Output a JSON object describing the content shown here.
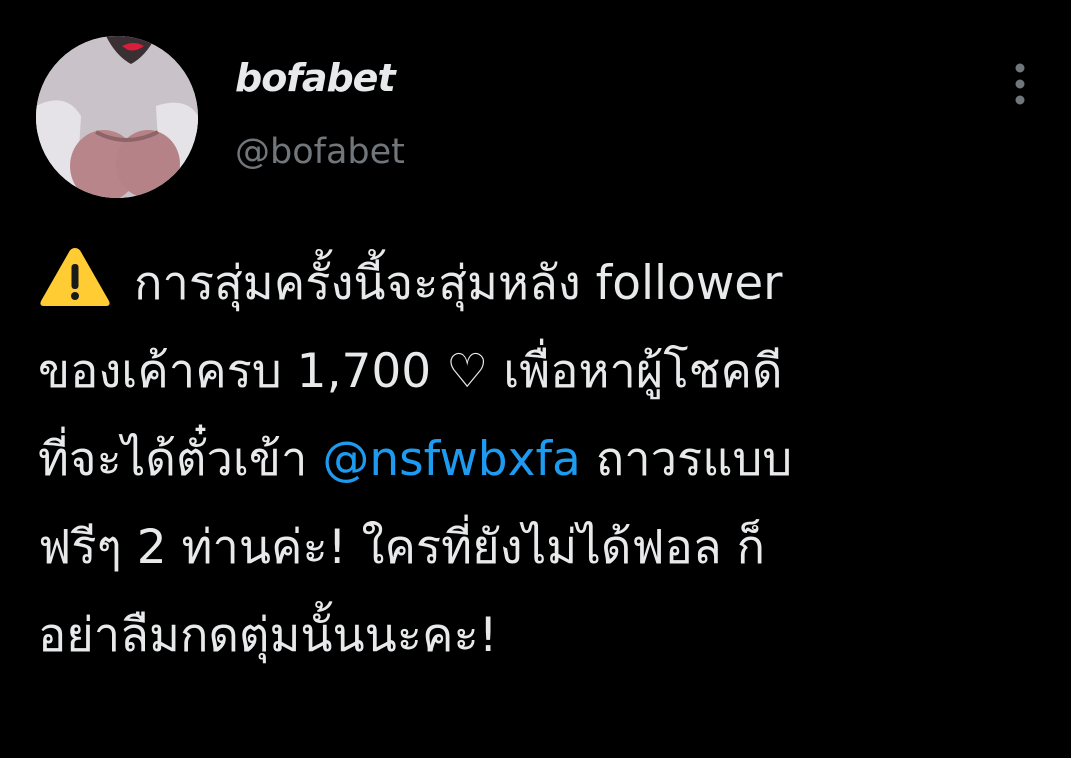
{
  "author": {
    "display_name": "bofabet",
    "handle": "@bofabet",
    "avatar_icon": "profile-photo"
  },
  "tweet": {
    "warning_icon": "warning-icon",
    "line1_text": "การสุ่มครั้งนี้จะสุ่มหลัง follower",
    "line2_text": "ของเค้าครบ 1,700 ♡ เพื่อหาผู้โชคดี",
    "line3_before": "ที่จะได้ตั๋วเข้า ",
    "line3_mention": "@nsfwbxfa",
    "line3_after": " ถาวรแบบ",
    "line4_text": "ฟรีๆ 2 ท่านค่ะ! ใครที่ยังไม่ได้ฟอล ก็",
    "line5_text": "อย่าลืมกดตุ่มนั้นนะคะ!"
  },
  "menu": {
    "more_icon": "more-vertical-icon"
  },
  "colors": {
    "background": "#000000",
    "text": "#e7e9ea",
    "secondary": "#71767b",
    "link": "#1d9bf0",
    "warning": "#ffcc33"
  }
}
